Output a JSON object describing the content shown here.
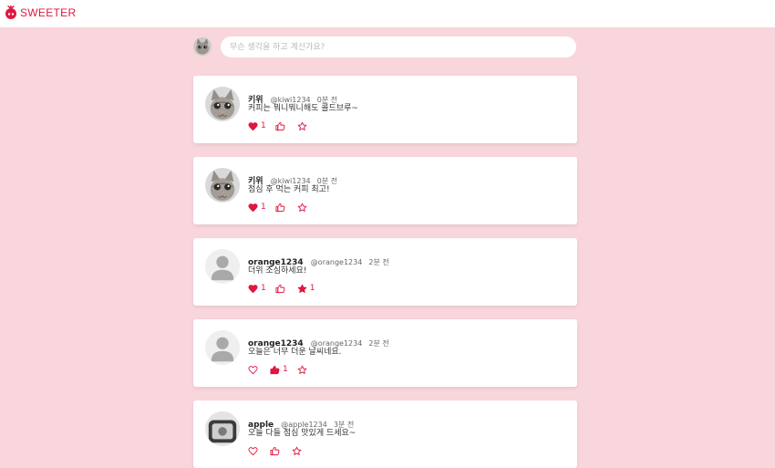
{
  "app": {
    "name": "SWEETER",
    "accent": "#e0173f",
    "background": "#f8d6dc"
  },
  "compose": {
    "placeholder": "무슨 생각을 하고 계신가요?",
    "avatar": "cat-photo"
  },
  "posts": [
    {
      "name": "키위",
      "handle": "@kiwi1234",
      "time": "0분 전",
      "text": "커피는 뭐니뭐니해도 콜드브루~",
      "avatar": "cat-photo",
      "heart": {
        "active": true,
        "count": "1"
      },
      "like": {
        "active": false,
        "count": ""
      },
      "star": {
        "active": false,
        "count": ""
      }
    },
    {
      "name": "키위",
      "handle": "@kiwi1234",
      "time": "0분 전",
      "text": "점심 후 먹는 커피 최고!",
      "avatar": "cat-photo",
      "heart": {
        "active": true,
        "count": "1"
      },
      "like": {
        "active": false,
        "count": ""
      },
      "star": {
        "active": false,
        "count": ""
      }
    },
    {
      "name": "orange1234",
      "handle": "@orange1234",
      "time": "2분 전",
      "text": "더위 조심하세요!",
      "avatar": "default-user",
      "heart": {
        "active": true,
        "count": "1"
      },
      "like": {
        "active": false,
        "count": ""
      },
      "star": {
        "active": true,
        "count": "1"
      }
    },
    {
      "name": "orange1234",
      "handle": "@orange1234",
      "time": "2분 전",
      "text": "오늘은 너무 더운 날씨네요.",
      "avatar": "default-user",
      "heart": {
        "active": false,
        "count": ""
      },
      "like": {
        "active": true,
        "count": "1"
      },
      "star": {
        "active": false,
        "count": ""
      }
    },
    {
      "name": "apple",
      "handle": "@apple1234",
      "time": "3분 전",
      "text": "오늘 다들 점심 맛있게 드세요~",
      "avatar": "photo",
      "heart": {
        "active": false,
        "count": ""
      },
      "like": {
        "active": false,
        "count": ""
      },
      "star": {
        "active": false,
        "count": ""
      }
    }
  ]
}
